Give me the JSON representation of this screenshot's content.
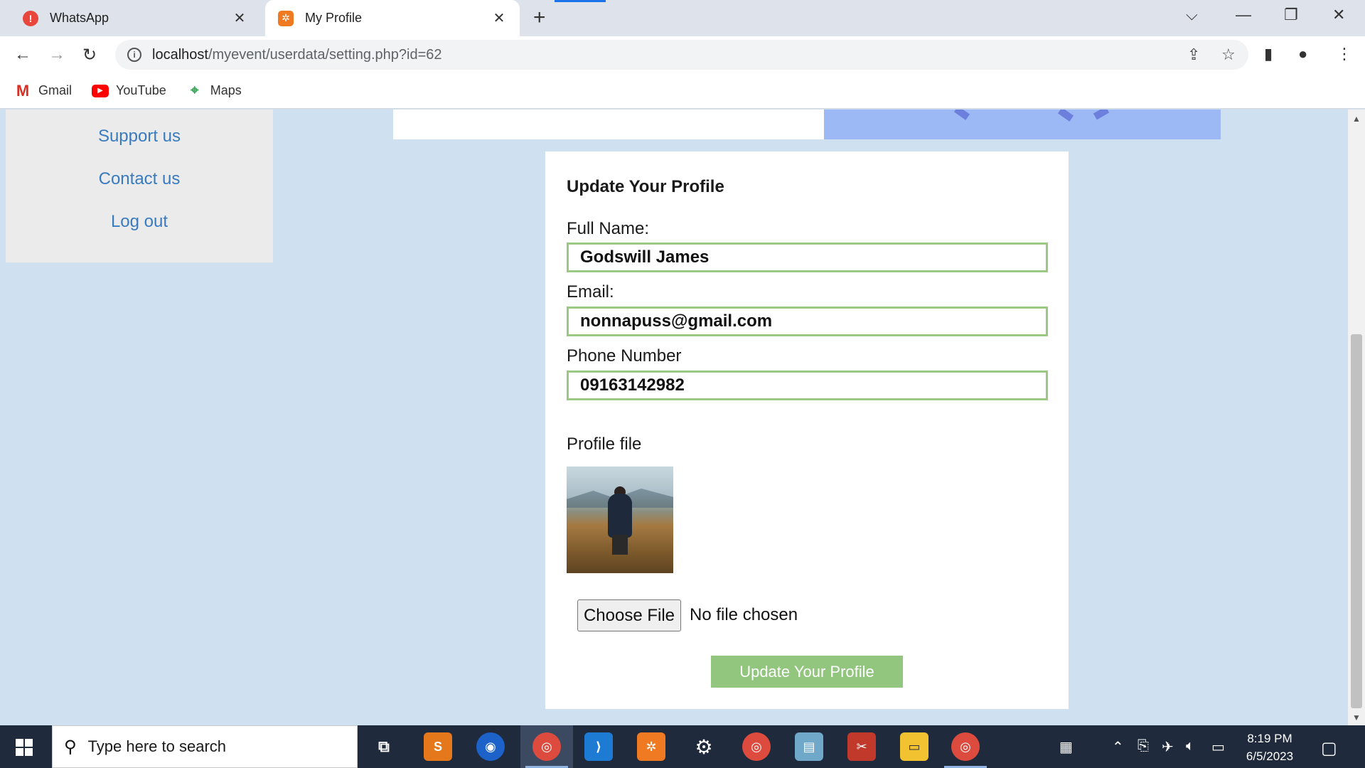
{
  "browser": {
    "tabs": [
      {
        "title": "WhatsApp",
        "icon": "whatsapp-alert-icon",
        "active": false
      },
      {
        "title": "My Profile",
        "icon": "xampp-icon",
        "active": true
      }
    ],
    "url_host": "localhost",
    "url_path": "/myevent/userdata/setting.php?id=62",
    "bookmarks": [
      {
        "label": "Gmail",
        "icon": "gmail-icon"
      },
      {
        "label": "YouTube",
        "icon": "youtube-icon"
      },
      {
        "label": "Maps",
        "icon": "maps-icon"
      }
    ]
  },
  "sidebar": {
    "links": [
      {
        "label": "Support us"
      },
      {
        "label": "Contact us"
      },
      {
        "label": "Log out"
      }
    ]
  },
  "form": {
    "heading": "Update Your Profile",
    "full_name_label": "Full Name:",
    "full_name_value": "Godswill James",
    "email_label": "Email:",
    "email_value": "nonnapuss@gmail.com",
    "phone_label": "Phone Number",
    "phone_value": "09163142982",
    "profile_file_label": "Profile file",
    "choose_file_label": "Choose File",
    "no_file_text": "No file chosen",
    "submit_label": "Update Your Profile"
  },
  "taskbar": {
    "search_placeholder": "Type here to search",
    "time": "8:19 PM",
    "date": "6/5/2023"
  },
  "colors": {
    "page_bg": "#cfe0f0",
    "field_border": "#9bc983",
    "submit_bg": "#92c57e",
    "link": "#3a7bbf",
    "hero_right": "#9cb8f5"
  }
}
